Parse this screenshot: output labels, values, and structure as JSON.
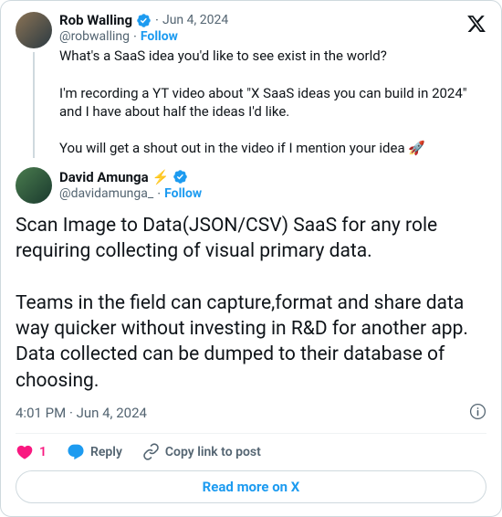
{
  "platform": {
    "name": "X"
  },
  "parent": {
    "name": "Rob Walling",
    "verified": true,
    "handle": "@robwalling",
    "follow": "Follow",
    "date": "Jun 4, 2024",
    "body": "What's a SaaS idea you'd like to see exist in the world?\n\nI'm recording a YT video about \"X SaaS ideas you can build in 2024\" and I have about half the ideas I'd like.\n\nYou will get a shout out in the video if I mention your idea 🚀"
  },
  "reply": {
    "name": "David Amunga",
    "emoji": "⚡",
    "verified": true,
    "handle": "@davidamunga_",
    "follow": "Follow",
    "body": "Scan Image to Data(JSON/CSV) SaaS for any role requiring collecting of visual primary data.\n\nTeams in the field can capture,format and share data way quicker without investing in R&D for another app. Data collected can be dumped to their database of choosing."
  },
  "meta": {
    "time": "4:01 PM",
    "date": "Jun 4, 2024"
  },
  "actions": {
    "like_count": "1",
    "reply_label": "Reply",
    "copy_label": "Copy link to post"
  },
  "read_more": "Read more on X"
}
